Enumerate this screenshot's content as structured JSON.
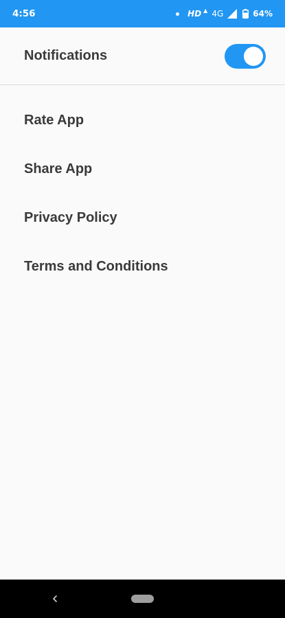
{
  "status_bar": {
    "time": "4:56",
    "hd": "HD",
    "network": "4G",
    "battery": "64%",
    "background": "#2196f3"
  },
  "settings": {
    "notifications": {
      "label": "Notifications",
      "enabled": true,
      "accent": "#2196f3"
    },
    "menu_items": [
      {
        "label": "Rate App"
      },
      {
        "label": "Share App"
      },
      {
        "label": "Privacy Policy"
      },
      {
        "label": "Terms and Conditions"
      }
    ]
  },
  "nav_bar": {
    "back_icon": "chevron-left-icon",
    "home_icon": "home-pill-icon"
  }
}
